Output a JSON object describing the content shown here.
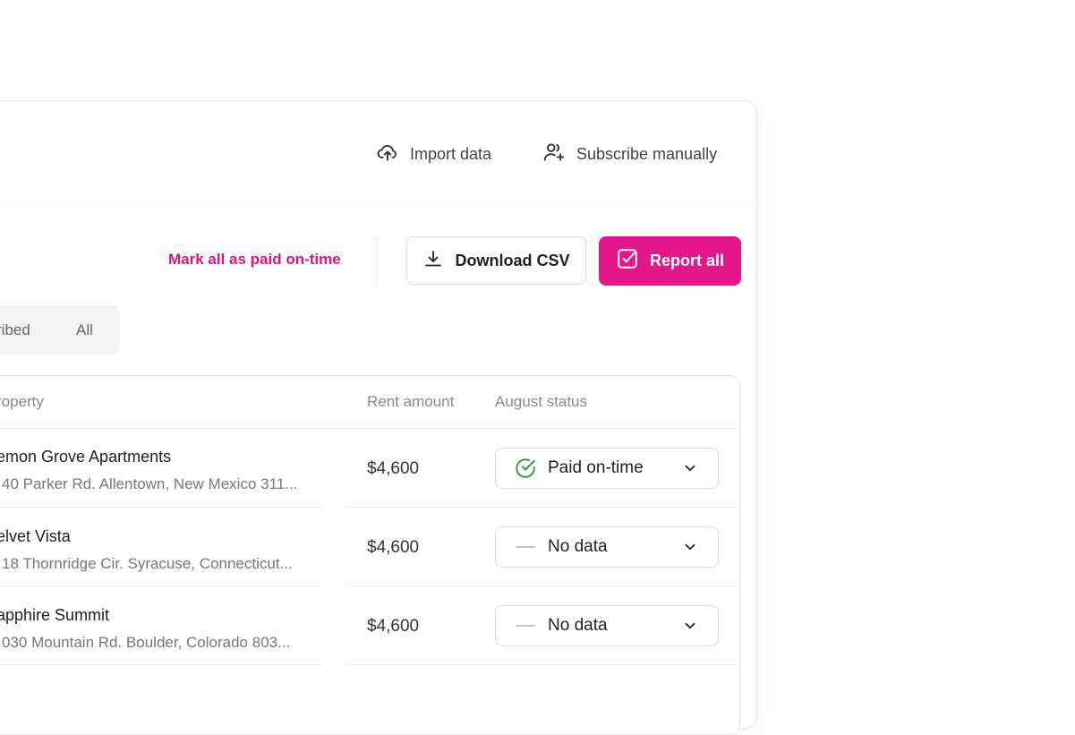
{
  "header": {
    "import_label": "Import data",
    "subscribe_label": "Subscribe manually"
  },
  "toolbar": {
    "mark_all_label": "Mark all as paid on-time",
    "download_label": "Download CSV",
    "report_label": "Report all"
  },
  "filters": {
    "tabs": [
      "ribed",
      "All"
    ]
  },
  "table": {
    "columns": [
      "roperty",
      "Rent amount",
      "August status"
    ],
    "rows": [
      {
        "name": "emon Grove Apartments",
        "address": "40 Parker Rd. Allentown, New Mexico 311...",
        "rent": "$4,600",
        "status": "Paid on-time"
      },
      {
        "name": "elvet Vista",
        "address": "18 Thornridge Cir. Syracuse, Connecticut...",
        "rent": "$4,600",
        "status": "No data"
      },
      {
        "name": "apphire Summit",
        "address": "030 Mountain Rd. Boulder, Colorado 803...",
        "rent": "$4,600",
        "status": "No data"
      }
    ]
  },
  "icons": {
    "import": "cloud-upload-icon",
    "subscribe": "user-plus-icon",
    "download": "download-icon",
    "report": "checkbox-icon",
    "paid": "check-circle-icon",
    "nodata": "dash-icon",
    "dropdown": "chevron-down-icon"
  },
  "colors": {
    "accent": "#e5168a",
    "success": "#3a9a3a"
  }
}
